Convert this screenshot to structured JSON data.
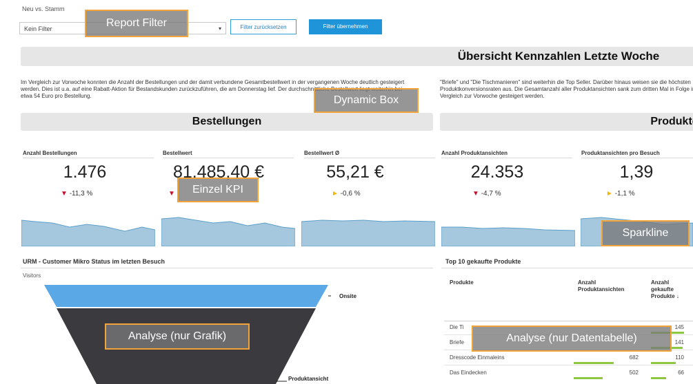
{
  "filter": {
    "label": "Neu vs. Stamm",
    "selected": "Kein Filter",
    "reset_button": "Filter zurücksetzen",
    "apply_button": "Filter übernehmen"
  },
  "page_title": "Übersicht Kennzahlen Letzte Woche",
  "summary_left": "Im Vergleich zur Vorwoche konnten die Anzahl der Bestellungen und der damit verbundene Gesamtbestellwert in der vergangenen Woche deutlich gesteigert werden. Dies ist u.a. auf eine Rabatt-Aktion für Bestandskunden zurückzuführen, die am Donnerstag lief. Der durchschnittliche Bestellwert liegt weiterhin bei etwa 54 Euro pro Bestellung.",
  "summary_right": "\"Briefe\" und \"Die Tischmanieren\" sind weiterhin die Top Seller. Darüber hinaus weisen sie die höchsten Produktkonversionsraten aus. Die Gesamtanzahl aller Produktansichten sank zum dritten Mal in Folge im Vergleich zur Vorwoche gesteigert werden.",
  "sections": {
    "orders": "Bestellungen",
    "products": "Produkte"
  },
  "kpis": [
    {
      "label": "Anzahl Bestellungen",
      "value": "1.476",
      "change": "-11,3 %",
      "trend": "down"
    },
    {
      "label": "Bestellwert",
      "value": "81.485,40 €",
      "change": "",
      "trend": "down"
    },
    {
      "label": "Bestellwert Ø",
      "value": "55,21 €",
      "change": "-0,6 %",
      "trend": "flat"
    },
    {
      "label": "Anzahl Produktansichten",
      "value": "24.353",
      "change": "-4,7 %",
      "trend": "down"
    },
    {
      "label": "Produktansichten pro Besuch",
      "value": "1,39",
      "change": "-1,1 %",
      "trend": "flat"
    }
  ],
  "trend_icons": {
    "down": "▼",
    "flat": "►"
  },
  "colors": {
    "down": "#c8102e",
    "flat": "#f5b400",
    "accent": "#1f94d8",
    "spark_fill": "#a6c8df",
    "spark_line": "#5b9ec9"
  },
  "funnel": {
    "title": "URM - Customer Mikro Status im letzten Besuch",
    "axis_label": "Visitors",
    "stages": [
      "Onsite",
      "Produktansicht"
    ]
  },
  "top_products": {
    "title": "Top 10 gekaufte Produkte",
    "columns": [
      "Produkte",
      "Anzahl Produktansichten",
      "Anzahl gekaufte Produkte ↓"
    ],
    "rows": [
      {
        "name": "Die Ti",
        "views": "",
        "bought": "145"
      },
      {
        "name": "Briefe",
        "views": "",
        "bought": "141"
      },
      {
        "name": "Dresscode Einmaleins",
        "views": "682",
        "bought": "110"
      },
      {
        "name": "Das Eindecken",
        "views": "502",
        "bought": "66"
      }
    ]
  },
  "callouts": {
    "report_filter": "Report Filter",
    "dynamic_box": "Dynamic Box",
    "einzel_kpi": "Einzel KPI",
    "sparkline": "Sparkline",
    "analyse_grafik": "Analyse (nur Grafik)",
    "analyse_tabelle": "Analyse (nur Datentabelle)"
  }
}
